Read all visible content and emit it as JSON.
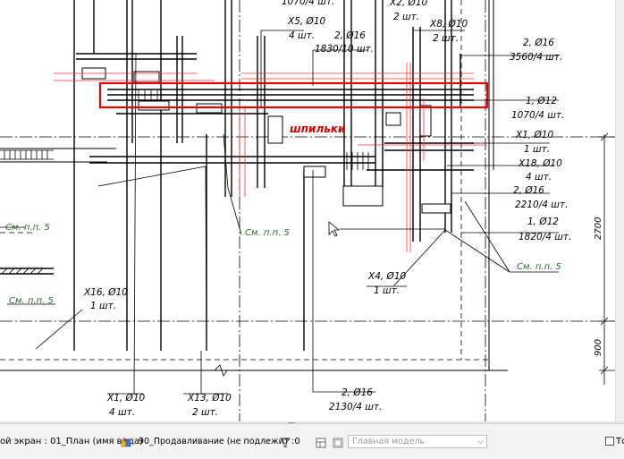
{
  "drawing": {
    "labels": {
      "top_cut": "1070/4 шт.",
      "x2_mark": "X2, Ø10",
      "x2_qty": "2 шт.",
      "x5_mark": "X5, Ø10",
      "x5_qty": "4 шт.",
      "x8_mark": "X8, Ø10",
      "x8_qty": "2 шт.",
      "bar2_top_mark": "2, Ø16",
      "bar2_top_len": "1830/10 шт.",
      "bar2_right_mark": "2, Ø16",
      "bar2_right_len": "3560/4 шт.",
      "bar1_mark": "1, Ø12",
      "bar1_len": "1070/4 шт.",
      "studs": "шпильки",
      "x1_right_mark": "X1, Ø10",
      "x1_right_qty": "1 шт.",
      "x18_mark": "X18, Ø10",
      "x18_qty": "4 шт.",
      "bar2_mid_mark": "2, Ø16",
      "bar2_mid_len": "2210/4 шт.",
      "bar1_mid_mark": "1, Ø12",
      "bar1_mid_len": "1820/4 шт.",
      "see_note_left": "См. п.п. 5",
      "see_note_center": "См. п.п. 5",
      "see_note_right": "См. п.п. 5",
      "see_note_lower_left": "См. п.п. 5",
      "x4_mark": "X4, Ø10",
      "x4_qty": "1 шт.",
      "x16_mark": "X16, Ø10",
      "x16_qty": "1 шт.",
      "x1_bottom_mark": "X1, Ø10",
      "x1_bottom_qty": "4 шт.",
      "x13_mark": "X13, Ø10",
      "x13_qty": "2 шт.",
      "bar2_bottom_mark": "2, Ø16",
      "bar2_bottom_len": "2130/4 шт.",
      "dim_2700": "2700",
      "dim_900": "900"
    }
  },
  "statusbar": {
    "view_text": "ой экран : 01_План (имя вида)",
    "workset_text": "90_Продавливание (не подлежит",
    "filter_count": ":0",
    "model_placeholder": "Главная модель",
    "checkbox_label": "То"
  },
  "colors": {
    "highlight": "#e00000",
    "red_lines": "#ff3030",
    "green_note": "#2a6a2a"
  },
  "icons": {
    "workset": "workset-icon",
    "filter": "filter-icon",
    "design_options": "design-options-icon",
    "model": "model-icon"
  }
}
